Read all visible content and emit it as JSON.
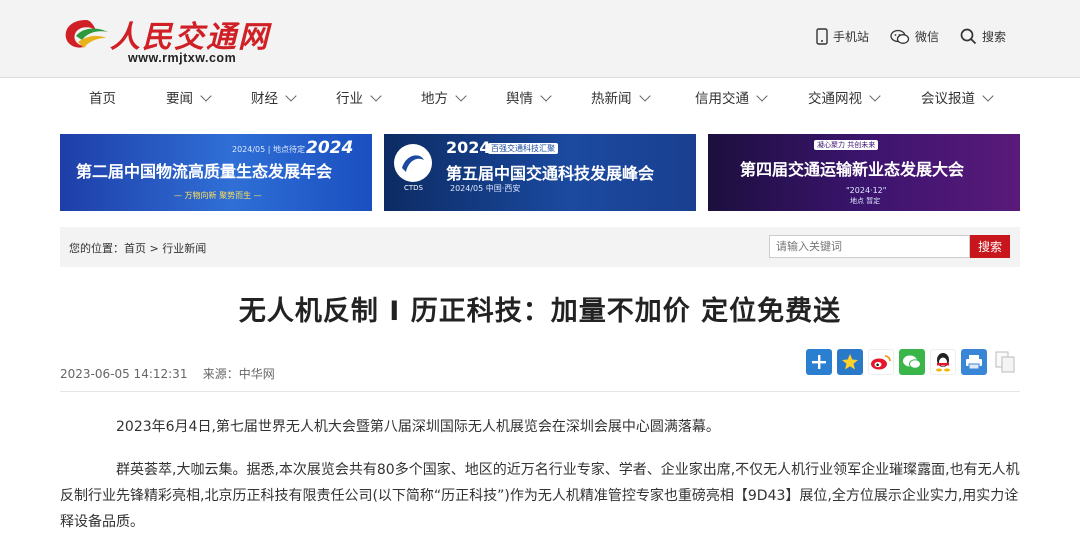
{
  "site": {
    "brand": "人民交通网",
    "url": "www.rmjtxw.com"
  },
  "header_links": [
    {
      "label": "手机站",
      "icon": "phone-icon"
    },
    {
      "label": "微信",
      "icon": "wechat-icon"
    },
    {
      "label": "搜索",
      "icon": "search-icon"
    }
  ],
  "nav": [
    {
      "label": "首页"
    },
    {
      "label": "要闻"
    },
    {
      "label": "财经"
    },
    {
      "label": "行业"
    },
    {
      "label": "地方"
    },
    {
      "label": "舆情"
    },
    {
      "label": "热新闻"
    },
    {
      "label": "信用交通"
    },
    {
      "label": "交通网视"
    },
    {
      "label": "会议报道"
    }
  ],
  "banners": [
    {
      "title": "第二届中国物流高质量生态发展年会",
      "year": "2024",
      "date": "2024/05 | 地点待定",
      "slogan": "— 万物向新 聚势而生 —"
    },
    {
      "title": "第五届中国交通科技发展峰会",
      "year": "2024",
      "tag": "百强交通科技汇聚",
      "date": "2024/05 中国·西安",
      "logo": "CTDS"
    },
    {
      "title": "第四届交通运输新业态发展大会",
      "tag": "凝心聚力 共创未来",
      "date": "\"2024·12\"",
      "place": "地点 暂定"
    }
  ],
  "breadcrumb": {
    "prefix": "您的位置：",
    "home": "首页",
    "sep": " > ",
    "current": "行业新闻"
  },
  "search": {
    "placeholder": "请输入关键词",
    "button": "搜索"
  },
  "article": {
    "title": "无人机反制 I 历正科技：加量不加价 定位免费送",
    "date": "2023-06-05 14:12:31",
    "source_label": "来源：",
    "source": "中华网",
    "paragraphs": [
      "2023年6月4日,第七届世界无人机大会暨第八届深圳国际无人机展览会在深圳会展中心圆满落幕。",
      "群英荟萃,大咖云集。据悉,本次展览会共有80多个国家、地区的近万名行业专家、学者、企业家出席,不仅无人机行业领军企业璀璨露面,也有无人机反制行业先锋精彩亮相,北京历正科技有限责任公司(以下简称“历正科技”)作为无人机精准管控专家也重磅亮相【9D43】展位,全方位展示企业实力,用实力诠释设备品质。"
    ]
  },
  "share_icons": [
    "share-plus-icon",
    "qzone-icon",
    "weibo-icon",
    "wechat-share-icon",
    "qq-icon",
    "print-icon",
    "copy-icon"
  ],
  "colors": {
    "accent": "#c8161d",
    "header_bg": "#f3f3f3"
  }
}
